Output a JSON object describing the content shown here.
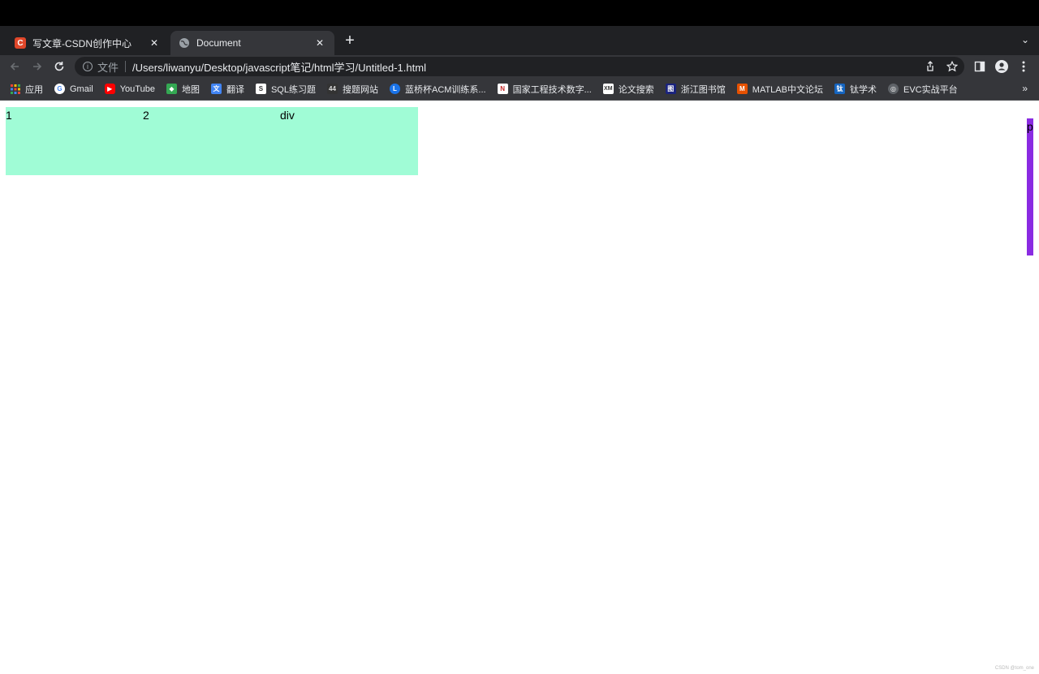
{
  "browser": {
    "tabs": [
      {
        "title": "写文章-CSDN创作中心",
        "favicon": "csdn-icon",
        "active": false
      },
      {
        "title": "Document",
        "favicon": "globe-icon",
        "active": true
      }
    ],
    "address": {
      "scheme_label": "文件",
      "url": "/Users/liwanyu/Desktop/javascript笔记/html学习/Untitled-1.html"
    },
    "bookmarks": [
      {
        "label": "应用",
        "icon": "apps-grid-icon",
        "color": "#e8eaed"
      },
      {
        "label": "Gmail",
        "icon": "google-icon",
        "color": "#ffffff"
      },
      {
        "label": "YouTube",
        "icon": "youtube-icon",
        "color": "#ff0000"
      },
      {
        "label": "地图",
        "icon": "maps-icon",
        "color": "#34a853"
      },
      {
        "label": "翻译",
        "icon": "translate-icon",
        "color": "#4285f4"
      },
      {
        "label": "SQL练习题",
        "icon": "sql-icon",
        "color": "#ffffff"
      },
      {
        "label": "搜题网站",
        "icon": "search-site-icon",
        "color": "#333333"
      },
      {
        "label": "蓝桥杯ACM训练系...",
        "icon": "lanqiao-icon",
        "color": "#1a73e8"
      },
      {
        "label": "国家工程技术数字...",
        "icon": "ngl-icon",
        "color": "#c62828"
      },
      {
        "label": "论文搜索",
        "icon": "xm-icon",
        "color": "#ffffff"
      },
      {
        "label": "浙江图书馆",
        "icon": "library-icon",
        "color": "#1a237e"
      },
      {
        "label": "MATLAB中文论坛",
        "icon": "matlab-icon",
        "color": "#e65100"
      },
      {
        "label": "钛学术",
        "icon": "titanium-icon",
        "color": "#1565c0"
      },
      {
        "label": "EVC实战平台",
        "icon": "evc-globe-icon",
        "color": "#5f6368"
      }
    ]
  },
  "page": {
    "box_cells": [
      "1",
      "2",
      "div"
    ],
    "p_label": "p",
    "watermark": "CSDN @tom_one",
    "colors": {
      "mint": "#a0fcd6",
      "purple": "#8a2be2"
    }
  }
}
